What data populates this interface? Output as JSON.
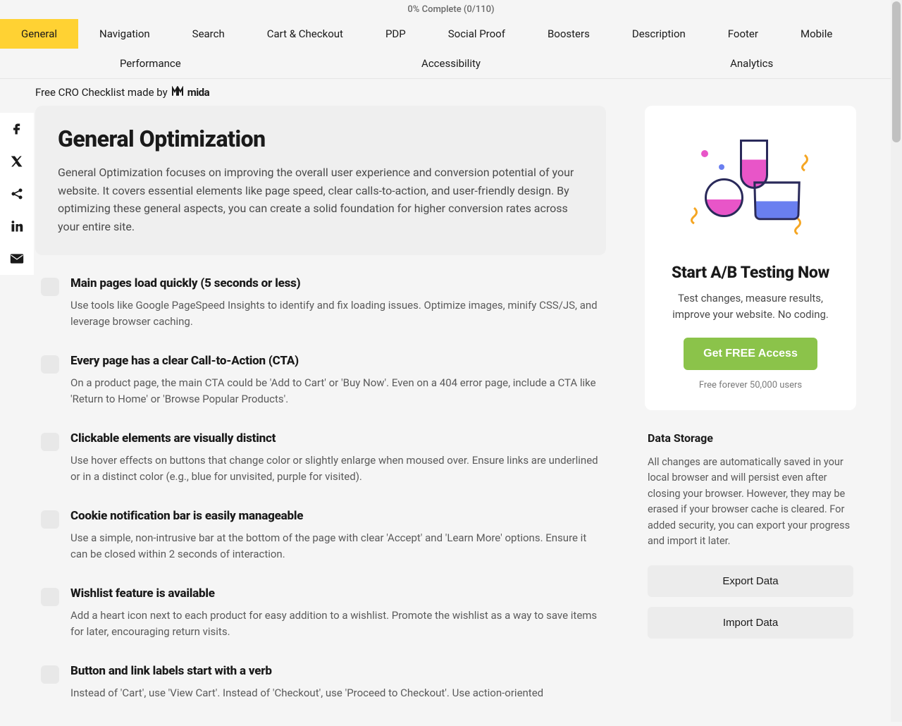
{
  "progress": {
    "text": "0% Complete (0/110)"
  },
  "tabs": [
    {
      "label": "General",
      "active": true
    },
    {
      "label": "Navigation"
    },
    {
      "label": "Search"
    },
    {
      "label": "Cart & Checkout"
    },
    {
      "label": "PDP"
    },
    {
      "label": "Social Proof"
    },
    {
      "label": "Boosters"
    },
    {
      "label": "Description"
    },
    {
      "label": "Footer"
    },
    {
      "label": "Mobile"
    },
    {
      "label": "Performance"
    },
    {
      "label": "Accessibility"
    },
    {
      "label": "Analytics"
    }
  ],
  "breadcrumb": {
    "text": "Free CRO Checklist made by",
    "brand": "mida"
  },
  "info": {
    "title": "General Optimization",
    "description": "General Optimization focuses on improving the overall user experience and conversion potential of your website. It covers essential elements like page speed, clear calls-to-action, and user-friendly design. By optimizing these general aspects, you can create a solid foundation for higher conversion rates across your entire site."
  },
  "checklist": [
    {
      "title": "Main pages load quickly (5 seconds or less)",
      "description": "Use tools like Google PageSpeed Insights to identify and fix loading issues. Optimize images, minify CSS/JS, and leverage browser caching."
    },
    {
      "title": "Every page has a clear Call-to-Action (CTA)",
      "description": "On a product page, the main CTA could be 'Add to Cart' or 'Buy Now'. Even on a 404 error page, include a CTA like 'Return to Home' or 'Browse Popular Products'."
    },
    {
      "title": "Clickable elements are visually distinct",
      "description": "Use hover effects on buttons that change color or slightly enlarge when moused over. Ensure links are underlined or in a distinct color (e.g., blue for unvisited, purple for visited)."
    },
    {
      "title": "Cookie notification bar is easily manageable",
      "description": "Use a simple, non-intrusive bar at the bottom of the page with clear 'Accept' and 'Learn More' options. Ensure it can be closed within 2 seconds of interaction."
    },
    {
      "title": "Wishlist feature is available",
      "description": "Add a heart icon next to each product for easy addition to a wishlist. Promote the wishlist as a way to save items for later, encouraging return visits."
    },
    {
      "title": "Button and link labels start with a verb",
      "description": "Instead of 'Cart', use 'View Cart'. Instead of 'Checkout', use 'Proceed to Checkout'. Use action-oriented"
    }
  ],
  "promo": {
    "title": "Start A/B Testing Now",
    "subtitle": "Test changes, measure results, improve your website. No coding.",
    "cta": "Get FREE Access",
    "disclaimer": "Free forever 50,000 users"
  },
  "storage": {
    "title": "Data Storage",
    "description": "All changes are automatically saved in your local browser and will persist even after closing your browser. However, they may be erased if your browser cache is cleared. For added security, you can export your progress and import it later.",
    "export": "Export Data",
    "import": "Import Data"
  }
}
